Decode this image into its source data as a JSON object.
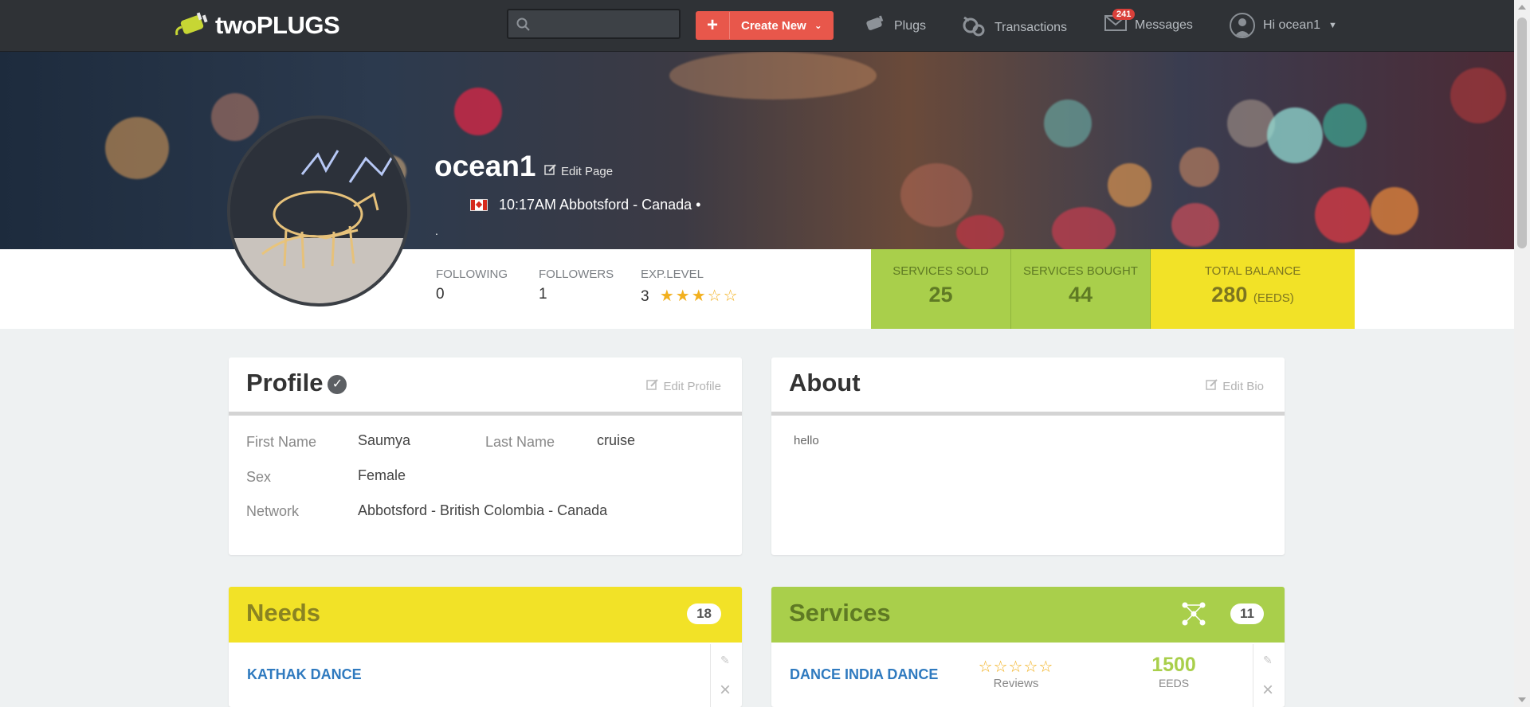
{
  "nav": {
    "logo_text": "twoPLUGS",
    "search_placeholder": "",
    "create_label": "Create New",
    "plugs_label": "Plugs",
    "transactions_label": "Transactions",
    "messages_label": "Messages",
    "messages_badge": "241",
    "user_label": "Hi ocean1"
  },
  "profile": {
    "username": "ocean1",
    "edit_page_label": "Edit Page",
    "local_time_location": "10:17AM Abbotsford - Canada •",
    "dot": ".",
    "following_label": "FOLLOWING",
    "following_value": "0",
    "followers_label": "FOLLOWERS",
    "followers_value": "1",
    "exp_label": "EXP.LEVEL",
    "exp_value": "3",
    "exp_stars_filled": 3,
    "exp_stars_total": 5,
    "services_sold_label": "SERVICES SOLD",
    "services_sold_value": "25",
    "services_bought_label": "SERVICES BOUGHT",
    "services_bought_value": "44",
    "balance_label": "TOTAL BALANCE",
    "balance_value": "280",
    "balance_unit": "(EEDS)"
  },
  "profile_card": {
    "title": "Profile",
    "edit_label": "Edit Profile",
    "first_name_label": "First Name",
    "first_name": "Saumya",
    "last_name_label": "Last Name",
    "last_name": "cruise",
    "sex_label": "Sex",
    "sex": "Female",
    "network_label": "Network",
    "network": "Abbotsford - British Colombia - Canada"
  },
  "about_card": {
    "title": "About",
    "edit_label": "Edit Bio",
    "bio": "hello"
  },
  "needs": {
    "title": "Needs",
    "count": "18",
    "color": "#f2e227",
    "items": [
      {
        "title": "KATHAK DANCE"
      }
    ]
  },
  "services": {
    "title": "Services",
    "count": "11",
    "color": "#a9cf4b",
    "items": [
      {
        "title": "DANCE INDIA DANCE",
        "rating": 0,
        "reviews_label": "Reviews",
        "price": "1500",
        "price_unit": "EEDS"
      }
    ]
  }
}
